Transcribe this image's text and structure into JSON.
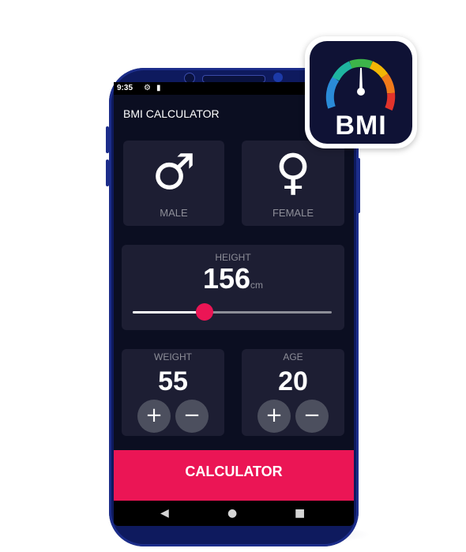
{
  "status_bar": {
    "time": "9:35"
  },
  "app": {
    "title": "BMI CALCULATOR"
  },
  "gender": {
    "male_label": "MALE",
    "female_label": "FEMALE",
    "male_symbol": "♂",
    "female_symbol": "♀"
  },
  "height": {
    "label": "HEIGHT",
    "value": "156",
    "unit": "cm",
    "slider_fraction": 0.36
  },
  "weight": {
    "label": "WEIGHT",
    "value": "55"
  },
  "age": {
    "label": "AGE",
    "value": "20"
  },
  "stepper": {
    "plus": "+",
    "minus": "−"
  },
  "calculate_button": {
    "label": "CALCULATOR"
  },
  "nav": {
    "back": "◀",
    "home": "●",
    "recents": "■"
  },
  "app_icon": {
    "text": "BMI"
  },
  "colors": {
    "background": "#0b0e21",
    "card": "#1d1e33",
    "accent": "#eb1555",
    "button_grey": "#4c4f5e",
    "label_grey": "#8d8e98",
    "phone_body": "#0e1a5e"
  }
}
